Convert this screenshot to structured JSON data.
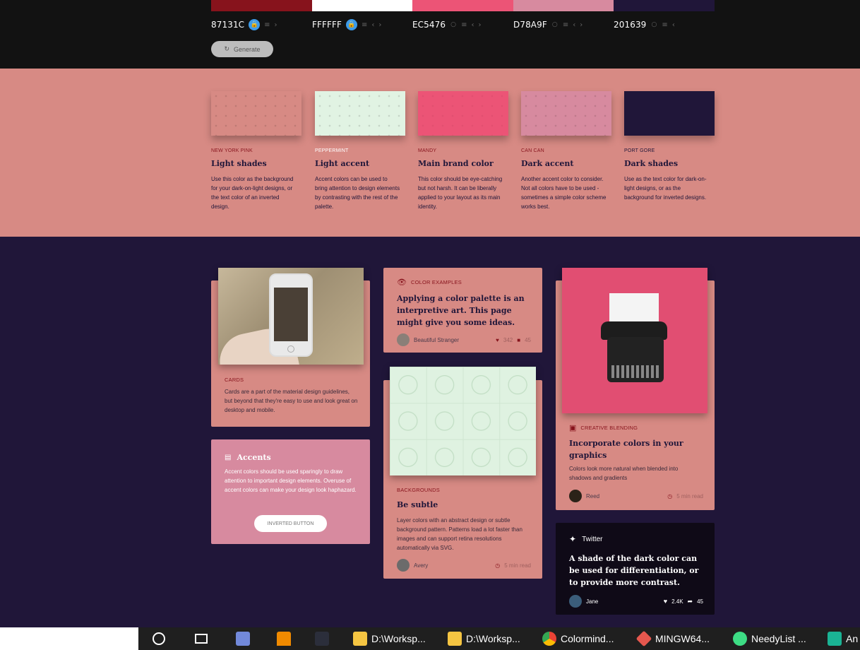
{
  "palette": {
    "swatches": [
      {
        "hex": "87131C",
        "color": "#87131C",
        "locked": true
      },
      {
        "hex": "FFFFFF",
        "color": "#FFFFFF",
        "locked": true
      },
      {
        "hex": "EC5476",
        "color": "#EC5476",
        "locked": false
      },
      {
        "hex": "D78A9F",
        "color": "#D78A9F",
        "locked": false
      },
      {
        "hex": "201639",
        "color": "#201639",
        "locked": false
      }
    ],
    "generate_label": "Generate"
  },
  "shades": [
    {
      "name": "NEW YORK PINK",
      "title": "Light shades",
      "desc": "Use this color as the background for your dark-on-light designs, or the text color of an inverted design.",
      "color": "#D78A84",
      "name_color": "#87131C"
    },
    {
      "name": "PEPPERMINT",
      "title": "Light accent",
      "desc": "Accent colors can be used to bring attention to design elements by contrasting with the rest of the palette.",
      "color": "#E1F3E3",
      "name_color": "#FFFFFF"
    },
    {
      "name": "MANDY",
      "title": "Main brand color",
      "desc": "This color should be eye-catching but not harsh. It can be liberally applied to your layout as its main identity.",
      "color": "#EC5476",
      "name_color": "#87131C"
    },
    {
      "name": "CAN CAN",
      "title": "Dark accent",
      "desc": "Another accent color to consider. Not all colors have to be used - sometimes a simple color scheme works best.",
      "color": "#D78A9F",
      "name_color": "#87131C"
    },
    {
      "name": "PORT GORE",
      "title": "Dark shades",
      "desc": "Use as the text color for dark-on-light designs, or as the background for inverted designs.",
      "color": "#201639",
      "name_color": "#201639"
    }
  ],
  "cards": {
    "cards_label": "CARDS",
    "cards_desc": "Cards are a part of the material design guidelines, but beyond that they're easy to use and look great on desktop and mobile.",
    "accents_title": "Accents",
    "accents_desc": "Accent colors should be used sparingly to draw attention to important design elements. Overuse of accent colors can make your design look haphazard.",
    "inverted_button": "INVERTED BUTTON",
    "examples_label": "COLOR EXAMPLES",
    "examples_title": "Applying a color palette is an interpretive art. This page might give you some ideas.",
    "examples_author": "Beautiful Stranger",
    "examples_likes": "342",
    "examples_comments": "45",
    "bg_label": "BACKGROUNDS",
    "bg_title": "Be subtle",
    "bg_desc": "Layer colors with an abstract design or subtle background pattern. Patterns load a lot faster than images and can support retina resolutions automatically via SVG.",
    "bg_author": "Avery",
    "bg_read": "5 min read",
    "blend_label": "CREATIVE BLENDING",
    "blend_title": "Incorporate colors in your graphics",
    "blend_desc": "Colors look more natural when blended into shadows and gradients",
    "blend_author": "Reed",
    "blend_read": "5 min read",
    "tw_label": "Twitter",
    "tw_text": "A shade of the dark color can be used for differentiation, or to provide more contrast.",
    "tw_author": "Jane",
    "tw_likes": "2.4K",
    "tw_shares": "45"
  },
  "taskbar": {
    "items": [
      {
        "label": "D:\\Worksp...",
        "icon": "folder-icon"
      },
      {
        "label": "D:\\Worksp...",
        "icon": "folder-icon"
      },
      {
        "label": "Colormind...",
        "icon": "chrome-icon"
      },
      {
        "label": "MINGW64...",
        "icon": "git-icon"
      },
      {
        "label": "NeedyList ...",
        "icon": "app-icon"
      },
      {
        "label": "An",
        "icon": "app-icon"
      }
    ]
  }
}
